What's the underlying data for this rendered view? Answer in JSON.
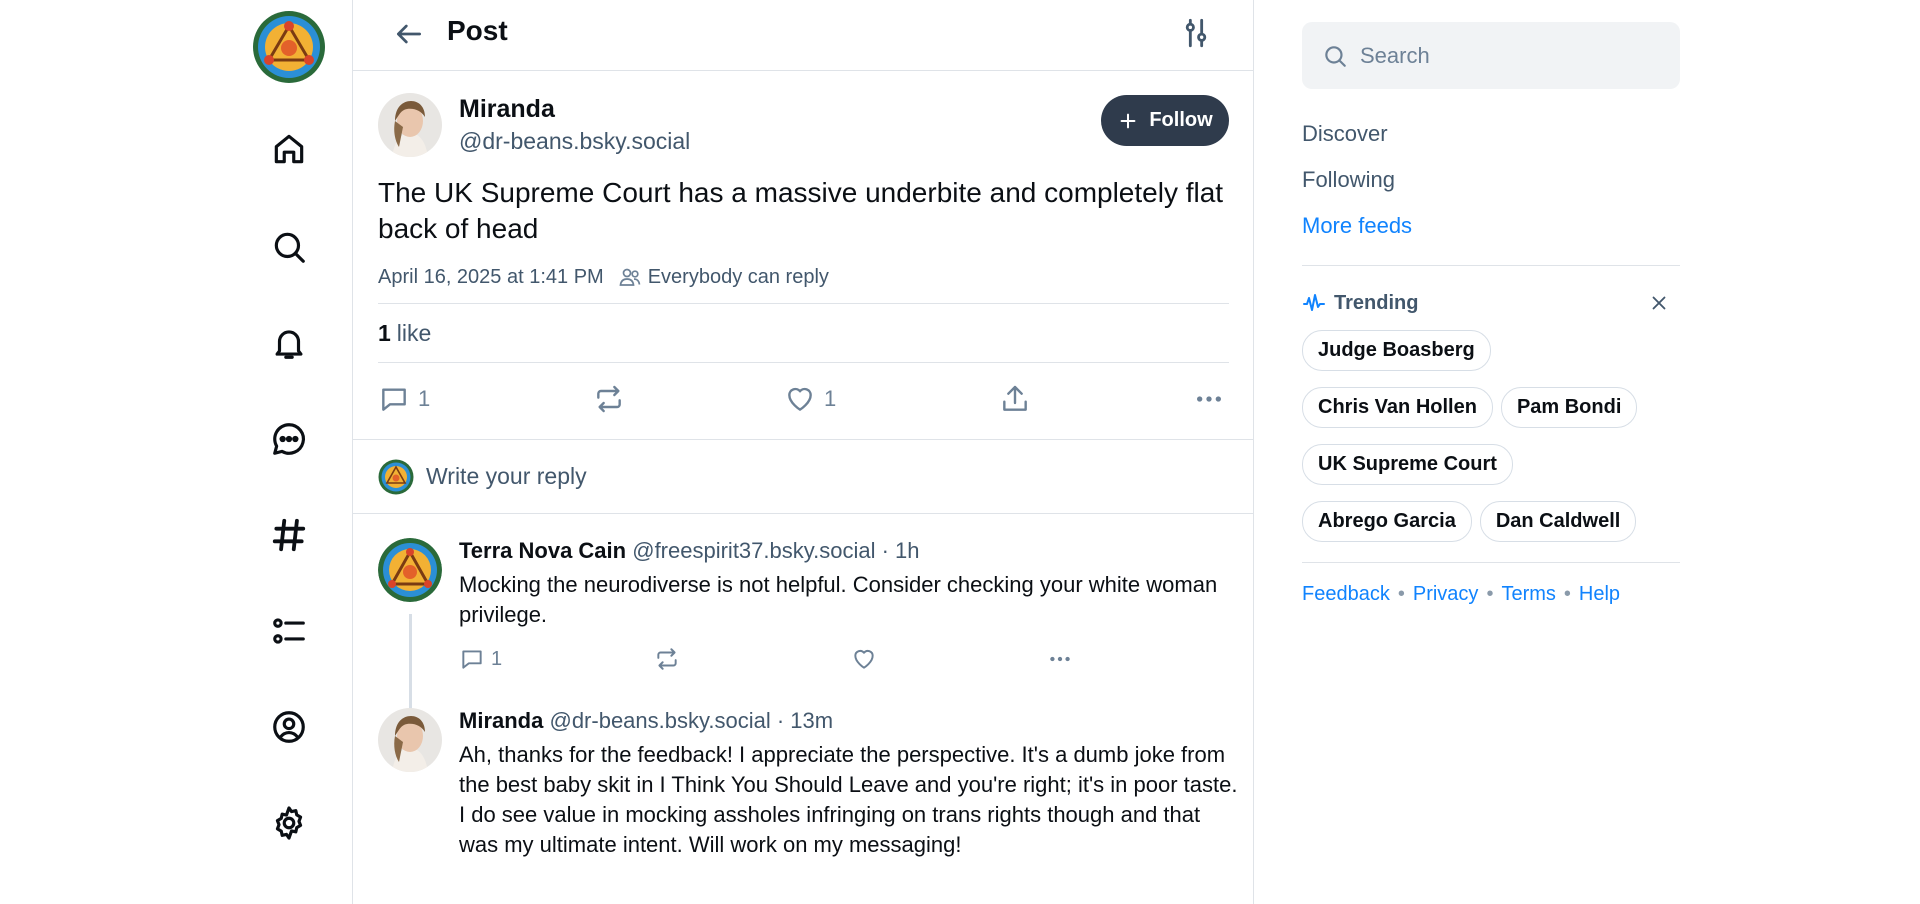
{
  "header": {
    "title": "Post"
  },
  "post": {
    "author_name": "Miranda",
    "author_handle": "@dr-beans.bsky.social",
    "follow_label": "Follow",
    "text": "The UK Supreme Court has a massive underbite and completely flat back of head",
    "timestamp": "April 16, 2025 at 1:41 PM",
    "reply_setting": "Everybody can reply",
    "likes_count": "1",
    "likes_label": "like",
    "reply_count": "1",
    "like_count": "1"
  },
  "reply_box": {
    "placeholder": "Write your reply"
  },
  "replies": [
    {
      "name": "Terra Nova Cain",
      "handle": "@freespirit37.bsky.social",
      "time": "· 1h",
      "text": "Mocking the neurodiverse is not helpful. Consider checking your white woman privilege.",
      "reply_count": "1"
    },
    {
      "name": "Miranda",
      "handle": "@dr-beans.bsky.social",
      "time": "· 13m",
      "text": "Ah, thanks for the feedback! I appreciate the perspective. It's a dumb joke from the best baby skit in I Think You Should Leave and you're right; it's in poor taste. I do see value in mocking assholes infringing on trans rights though and that was my ultimate intent. Will work on my messaging!"
    }
  ],
  "sidebar_right": {
    "search_placeholder": "Search",
    "feeds": [
      "Discover",
      "Following",
      "More feeds"
    ],
    "trending_title": "Trending",
    "trending": [
      "Judge Boasberg",
      "Chris Van Hollen",
      "Pam Bondi",
      "UK Supreme Court",
      "Abrego Garcia",
      "Dan Caldwell"
    ],
    "footer": [
      "Feedback",
      "Privacy",
      "Terms",
      "Help"
    ]
  },
  "colors": {
    "accent": "#1083fe",
    "follow_bg": "#2f3b4c",
    "muted": "#42576c"
  }
}
